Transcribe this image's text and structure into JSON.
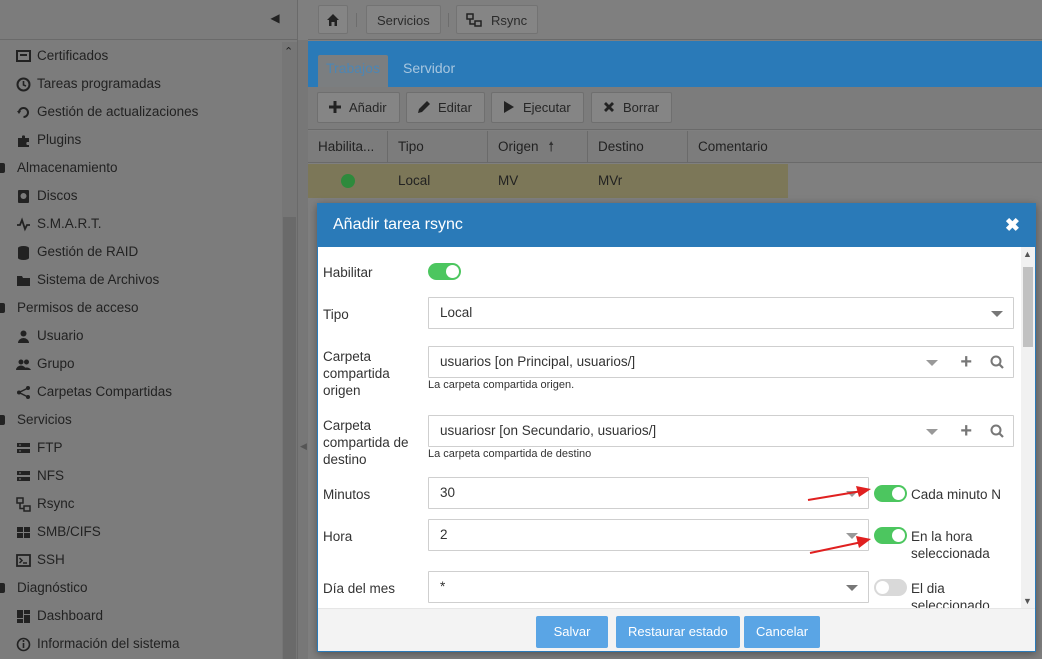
{
  "sidebar": {
    "items": [
      {
        "label": "Certificados",
        "icon": "certificate-icon",
        "type": "child"
      },
      {
        "label": "Tareas programadas",
        "icon": "clock-icon",
        "type": "child"
      },
      {
        "label": "Gestión de actualizaciones",
        "icon": "refresh-icon",
        "type": "child"
      },
      {
        "label": "Plugins",
        "icon": "puzzle-icon",
        "type": "child"
      },
      {
        "label": "Almacenamiento",
        "icon": "",
        "type": "group"
      },
      {
        "label": "Discos",
        "icon": "disk-icon",
        "type": "child"
      },
      {
        "label": "S.M.A.R.T.",
        "icon": "pulse-icon",
        "type": "child"
      },
      {
        "label": "Gestión de RAID",
        "icon": "database-icon",
        "type": "child"
      },
      {
        "label": "Sistema de Archivos",
        "icon": "folder-icon",
        "type": "child"
      },
      {
        "label": "Permisos de acceso",
        "icon": "",
        "type": "group"
      },
      {
        "label": "Usuario",
        "icon": "user-icon",
        "type": "child"
      },
      {
        "label": "Grupo",
        "icon": "users-icon",
        "type": "child"
      },
      {
        "label": "Carpetas Compartidas",
        "icon": "share-icon",
        "type": "child"
      },
      {
        "label": "Servicios",
        "icon": "",
        "type": "group"
      },
      {
        "label": "FTP",
        "icon": "server-icon",
        "type": "child"
      },
      {
        "label": "NFS",
        "icon": "server-icon",
        "type": "child"
      },
      {
        "label": "Rsync",
        "icon": "rsync-icon",
        "type": "child"
      },
      {
        "label": "SMB/CIFS",
        "icon": "windows-icon",
        "type": "child"
      },
      {
        "label": "SSH",
        "icon": "terminal-icon",
        "type": "child"
      },
      {
        "label": "Diagnóstico",
        "icon": "",
        "type": "group"
      },
      {
        "label": "Dashboard",
        "icon": "dashboard-icon",
        "type": "child"
      },
      {
        "label": "Información del sistema",
        "icon": "info-icon",
        "type": "child"
      }
    ]
  },
  "breadcrumb": {
    "home_icon": "home-icon",
    "items": [
      "Servicios",
      "Rsync"
    ]
  },
  "tabs": [
    "Trabajos",
    "Servidor"
  ],
  "toolbar": {
    "add": "Añadir",
    "edit": "Editar",
    "run": "Ejecutar",
    "delete": "Borrar"
  },
  "grid": {
    "columns": [
      "Habilita...",
      "Tipo",
      "Origen",
      "Destino",
      "Comentario"
    ],
    "sort_column": "Origen",
    "rows": [
      {
        "enabled": true,
        "tipo": "Local",
        "origen": "MV",
        "destino": "MVr",
        "comentario": ""
      }
    ]
  },
  "modal": {
    "title": "Añadir tarea rsync",
    "fields": {
      "habilitar": {
        "label": "Habilitar",
        "value": true
      },
      "tipo": {
        "label": "Tipo",
        "value": "Local"
      },
      "origen": {
        "label": "Carpeta compartida origen",
        "value": "usuarios [on Principal, usuarios/]",
        "hint": "La carpeta compartida origen."
      },
      "destino": {
        "label": "Carpeta compartida de destino",
        "value": "usuariosr [on Secundario, usuarios/]",
        "hint": "La carpeta compartida de destino"
      },
      "minutos": {
        "label": "Minutos",
        "value": "30",
        "toggle": true,
        "toggle_label": "Cada minuto N"
      },
      "hora": {
        "label": "Hora",
        "value": "2",
        "toggle": true,
        "toggle_label": "En la hora seleccionada"
      },
      "dia": {
        "label": "Día del mes",
        "value": "*",
        "toggle": false,
        "toggle_label": "El dia seleccionado"
      }
    },
    "buttons": {
      "save": "Salvar",
      "reset": "Restaurar estado",
      "cancel": "Cancelar"
    }
  },
  "colors": {
    "accent": "#2a7ab8",
    "toggle_on": "#4cc65f",
    "button": "#5aa5e5",
    "arrow": "#e02020"
  }
}
